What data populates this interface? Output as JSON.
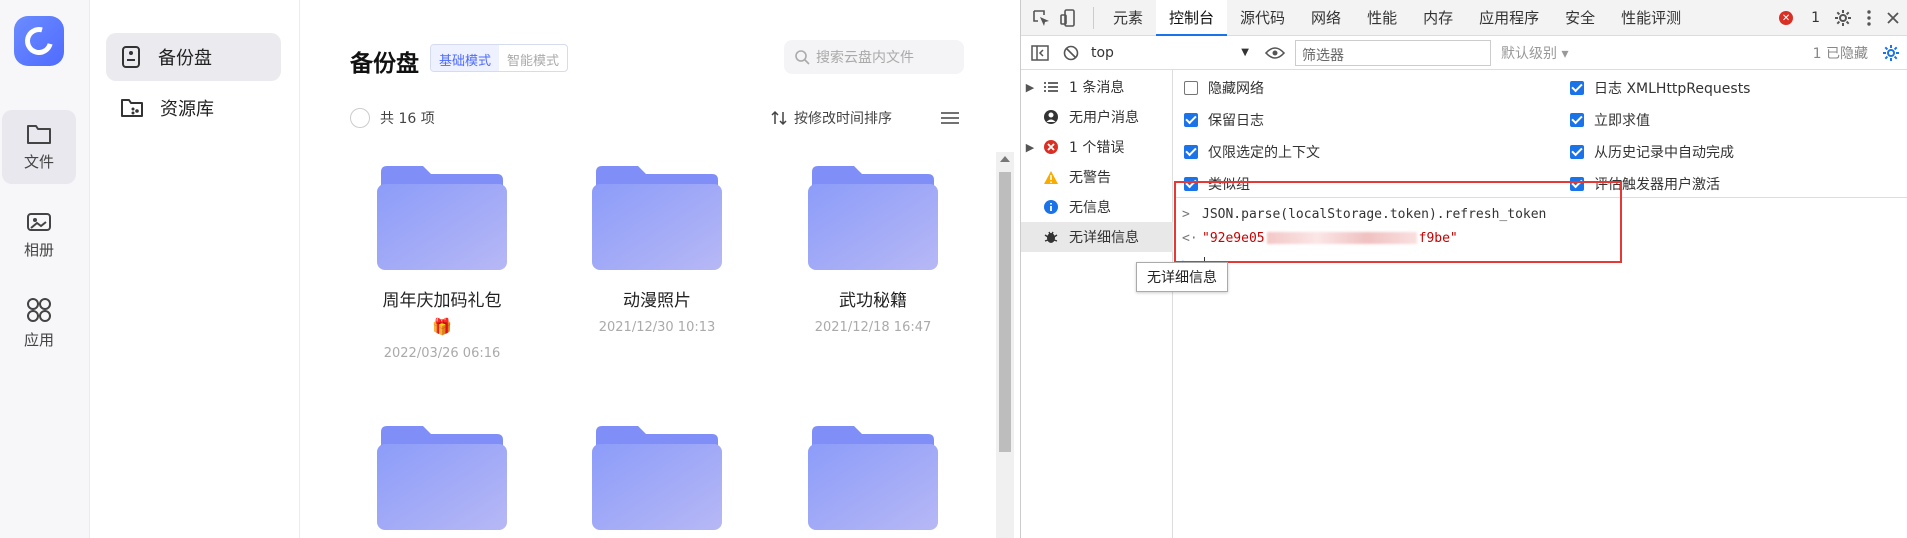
{
  "rail": {
    "items": [
      {
        "label": "文件",
        "icon": "folder-icon"
      },
      {
        "label": "相册",
        "icon": "photo-icon"
      },
      {
        "label": "应用",
        "icon": "apps-icon"
      }
    ]
  },
  "side": {
    "items": [
      {
        "label": "备份盘",
        "icon": "drive-icon"
      },
      {
        "label": "资源库",
        "icon": "library-icon"
      }
    ]
  },
  "main": {
    "title": "备份盘",
    "mode_basic": "基础模式",
    "mode_smart": "智能模式",
    "search_placeholder": "搜索云盘内文件",
    "count": "共 16 项",
    "sort": "按修改时间排序",
    "folders": [
      {
        "name": "周年庆加码礼包",
        "emoji": "🎁",
        "date": "2022/03/26 06:16"
      },
      {
        "name": "动漫照片",
        "date": "2021/12/30 10:13"
      },
      {
        "name": "武功秘籍",
        "date": "2021/12/18 16:47"
      }
    ]
  },
  "devtools": {
    "tabs": [
      "元素",
      "控制台",
      "源代码",
      "网络",
      "性能",
      "内存",
      "应用程序",
      "安全",
      "性能评测"
    ],
    "active_tab": "控制台",
    "error_count": "1",
    "context": "top",
    "filter_placeholder": "筛选器",
    "levels": "默认级别 ▾",
    "hidden": "1 已隐藏",
    "sidebar": [
      "1 条消息",
      "无用户消息",
      "1 个错误",
      "无警告",
      "无信息",
      "无详细信息"
    ],
    "settings_left": [
      {
        "label": "隐藏网络",
        "checked": false
      },
      {
        "label": "保留日志",
        "checked": true
      },
      {
        "label": "仅限选定的上下文",
        "checked": true
      },
      {
        "label": "类似组",
        "checked": true
      }
    ],
    "settings_right": [
      {
        "label": "日志 XMLHttpRequests",
        "checked": true
      },
      {
        "label": "立即求值",
        "checked": true
      },
      {
        "label": "从历史记录中自动完成",
        "checked": true
      },
      {
        "label": "评估触发器用户激活",
        "checked": true
      }
    ],
    "console_input": "JSON.parse(localStorage.token).refresh_token",
    "console_result_start": "\"92e9e05",
    "console_result_end": "f9be\"",
    "tooltip": "无详细信息"
  },
  "colors": {
    "accent": "#4e6bff",
    "devtools_blue": "#1a73e8",
    "error_red": "#d93025",
    "highlight": "#e53935"
  }
}
